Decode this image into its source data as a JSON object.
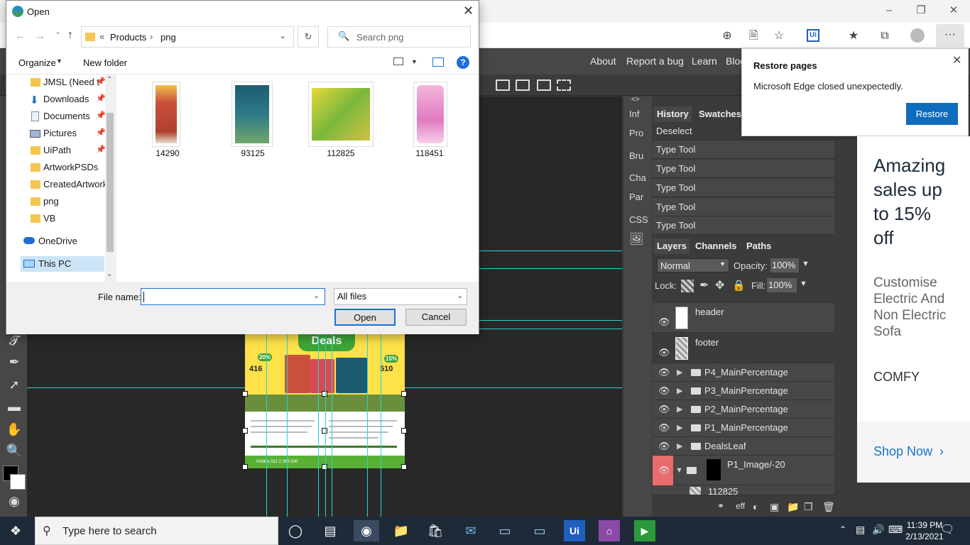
{
  "edge": {
    "more_label": "···",
    "ui_label": "Ui"
  },
  "photopea": {
    "menu": [
      "About",
      "Report a bug",
      "Learn",
      "Blog"
    ],
    "side_strip": [
      "Inf",
      "Pro",
      "Bru",
      "Cha",
      "Par",
      "CSS"
    ],
    "tabs": {
      "history": "History",
      "swatches": "Swatches",
      "layers": "Layers",
      "channels": "Channels",
      "paths": "Paths"
    },
    "history_items": [
      "Deselect",
      "Type Tool",
      "Type Tool",
      "Type Tool",
      "Type Tool",
      "Type Tool"
    ],
    "blend_mode": "Normal",
    "opacity_label": "Opacity:",
    "opacity_value": "100%",
    "lock_label": "Lock:",
    "fill_label": "Fill:",
    "fill_value": "100%",
    "layers": [
      {
        "name": "header"
      },
      {
        "name": "footer"
      },
      {
        "name": "P4_MainPercentage"
      },
      {
        "name": "P3_MainPercentage"
      },
      {
        "name": "P2_MainPercentage"
      },
      {
        "name": "P1_MainPercentage"
      },
      {
        "name": "DealsLeaf"
      },
      {
        "name": "P1_Image/-20"
      },
      {
        "name": "112825"
      }
    ],
    "layer_footer_label": "eff",
    "doc": {
      "deals": "Deals",
      "price_left": "416",
      "price_right": "510",
      "badge_left": "20%",
      "badge_right": "15%",
      "footer_text": "Hotline 011 2 303 500"
    }
  },
  "restore": {
    "title": "Restore pages",
    "message": "Microsoft Edge closed unexpectedly.",
    "button": "Restore"
  },
  "ad": {
    "headline_1": "Amazing",
    "headline_2": "sales up",
    "headline_3": "to 15%",
    "headline_4": "off",
    "sub_1": "Customise",
    "sub_2": "Electric And",
    "sub_3": "Non Electric",
    "sub_4": "Sofa",
    "brand": "COMFY",
    "cta": "Shop Now"
  },
  "dialog": {
    "title": "Open",
    "breadcrumb": [
      "Products",
      "png"
    ],
    "search_placeholder": "Search png",
    "organize": "Organize",
    "new_folder": "New folder",
    "nav_items": [
      "JMSL (Need t",
      "Downloads",
      "Documents",
      "Pictures",
      "UiPath",
      "ArtworkPSDs",
      "CreatedArtworks",
      "png",
      "VB",
      "OneDrive",
      "This PC"
    ],
    "files": [
      "14290",
      "93125",
      "112825",
      "118451"
    ],
    "filename_label": "File name:",
    "filename_value": "",
    "filetype": "All files",
    "open_button": "Open",
    "cancel_button": "Cancel"
  },
  "taskbar": {
    "search_placeholder": "Type here to search",
    "time": "11:39 PM",
    "date": "2/13/2021"
  }
}
